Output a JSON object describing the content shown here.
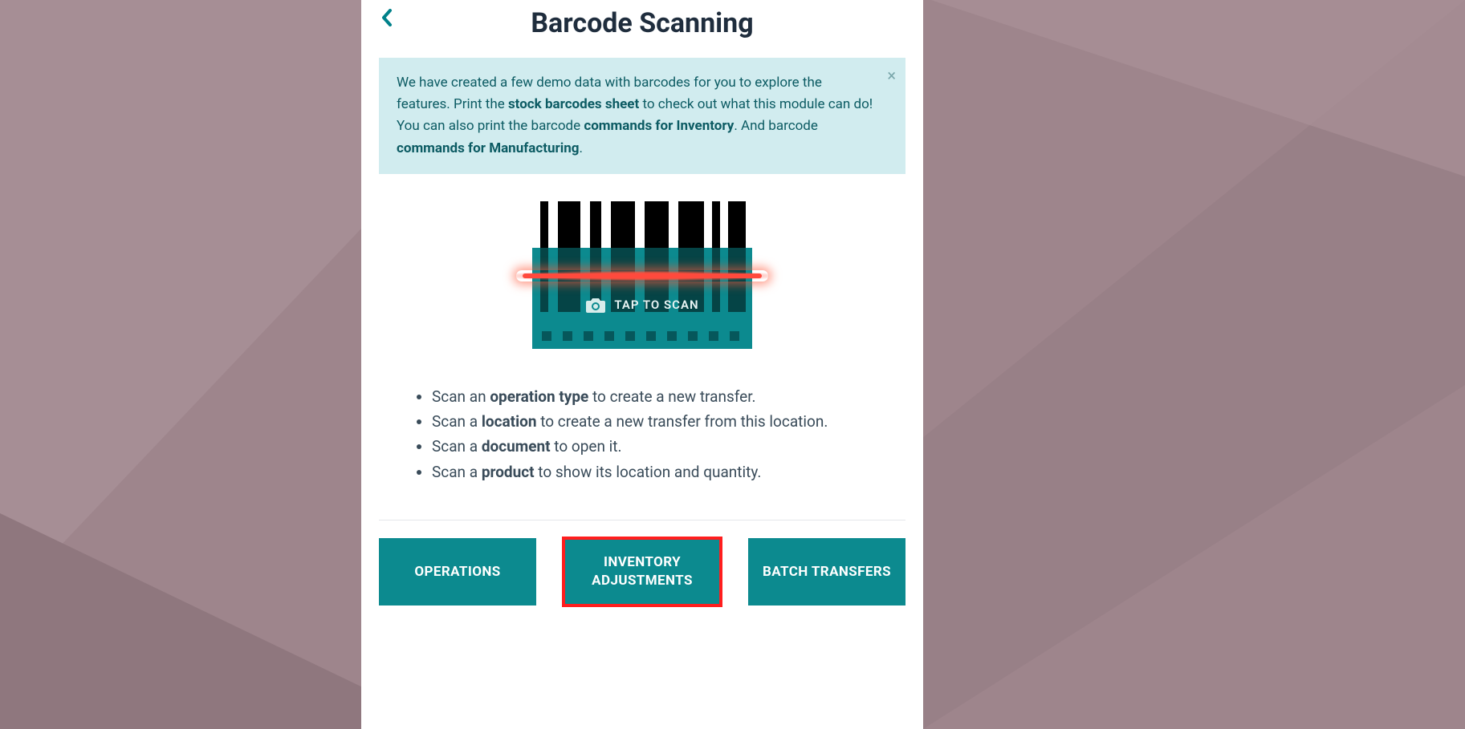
{
  "header": {
    "title": "Barcode Scanning"
  },
  "alert": {
    "part1": "We have created a few demo data with barcodes for you to explore the features. Print the ",
    "link1": "stock barcodes sheet",
    "part2": " to check out what this module can do! You can also print the barcode ",
    "link2": "commands for Inventory",
    "part3": ". And barcode ",
    "link3": "commands for Manufacturing",
    "part4": "."
  },
  "scan": {
    "tap_label": "TAP TO SCAN"
  },
  "instructions": [
    {
      "pre": "Scan an ",
      "bold": "operation type",
      "post": " to create a new transfer."
    },
    {
      "pre": "Scan a ",
      "bold": "location",
      "post": " to create a new transfer from this location."
    },
    {
      "pre": "Scan a ",
      "bold": "document",
      "post": " to open it."
    },
    {
      "pre": "Scan a ",
      "bold": "product",
      "post": " to show its location and quantity."
    }
  ],
  "buttons": {
    "operations": "OPERATIONS",
    "inventory_adjustments": "INVENTORY ADJUSTMENTS",
    "batch_transfers": "BATCH TRANSFERS"
  }
}
